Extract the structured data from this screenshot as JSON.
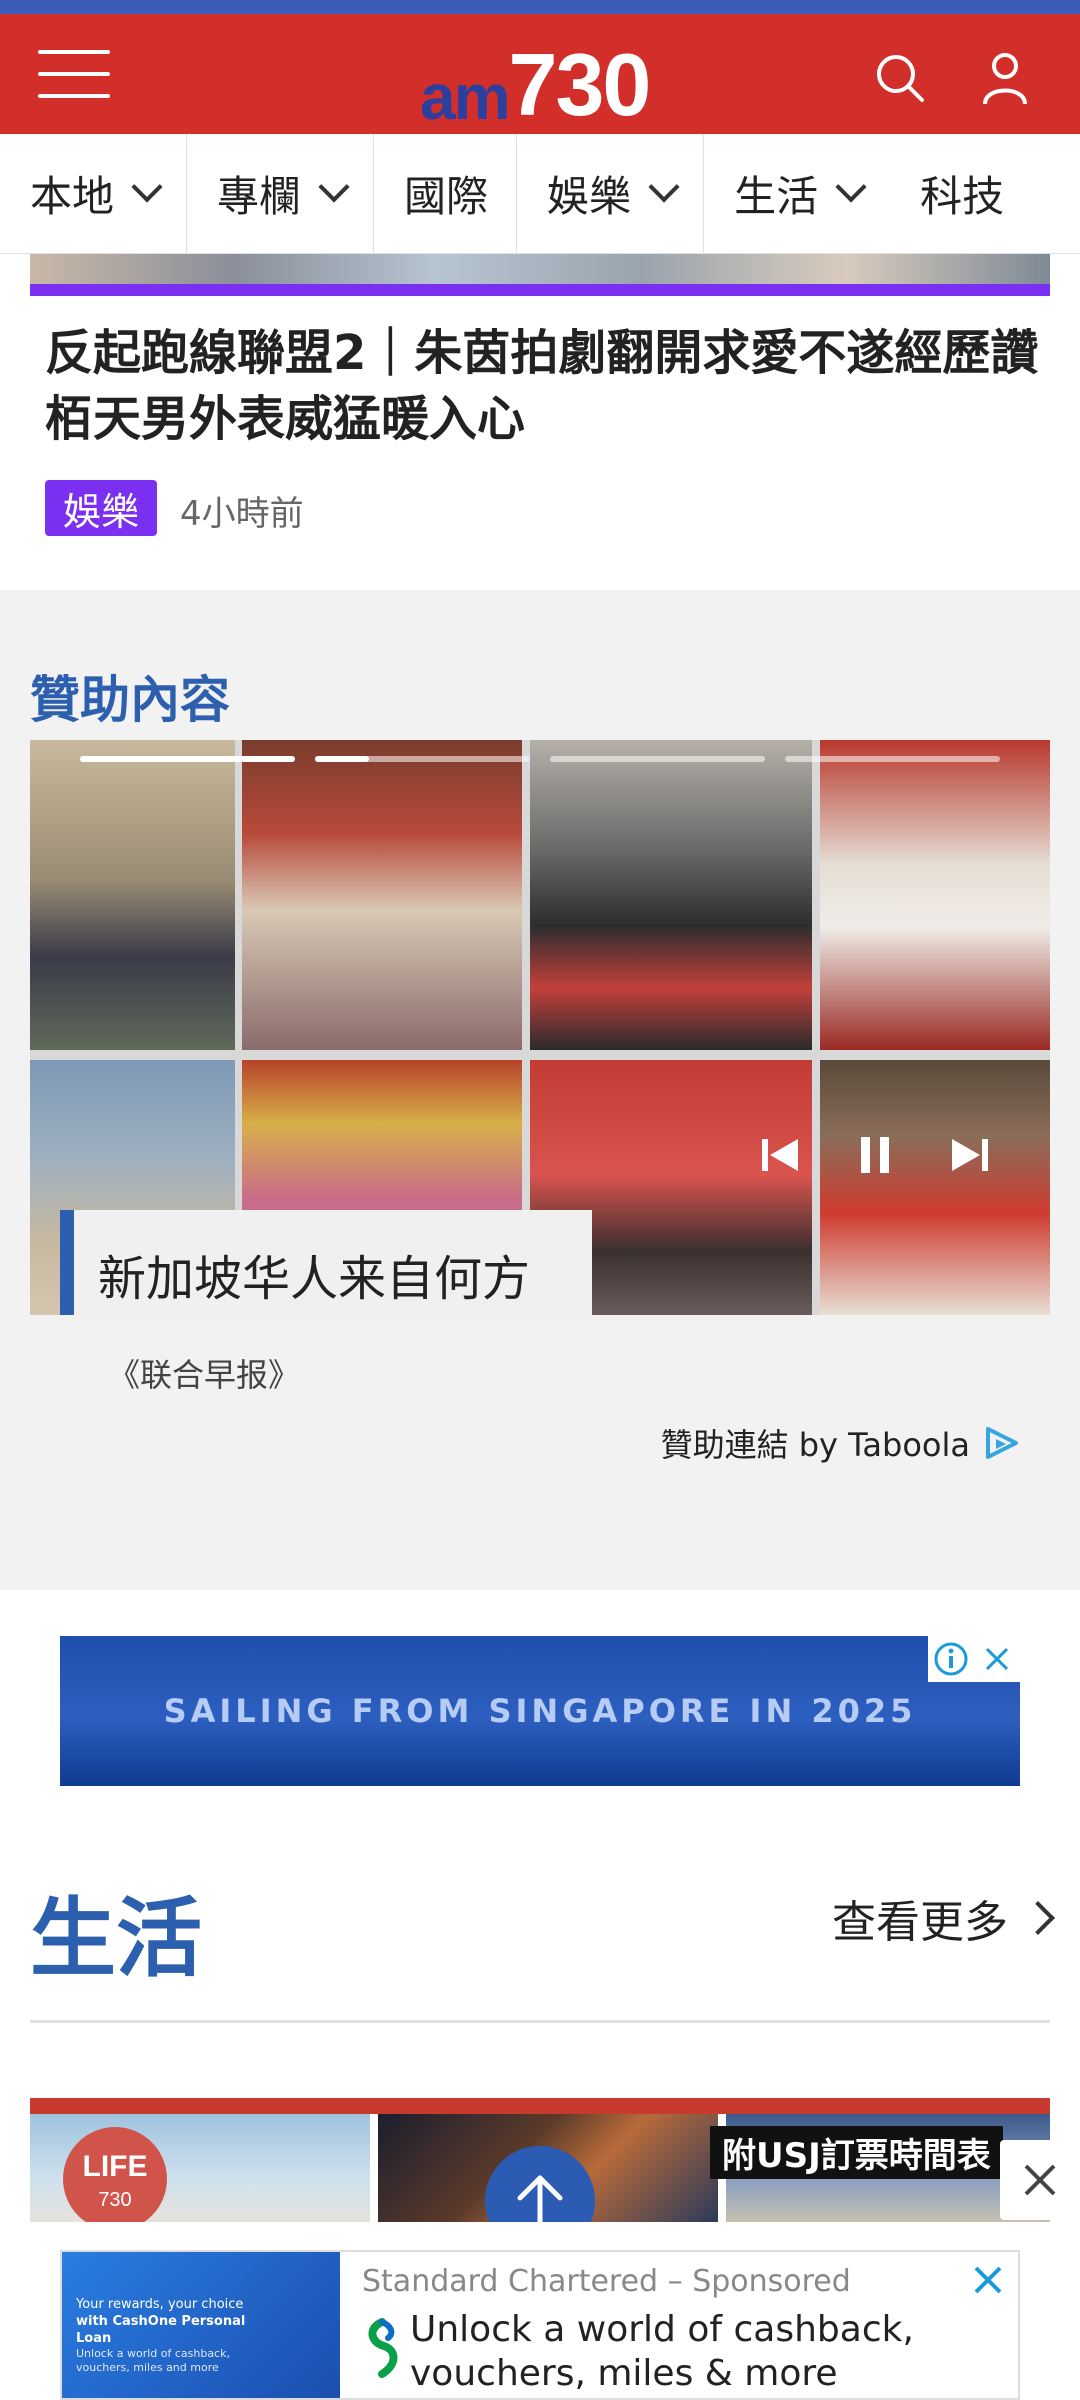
{
  "header": {
    "logo_prefix": "am",
    "logo_number": "730"
  },
  "nav": {
    "categories": [
      {
        "label": "本地",
        "has_dropdown": true
      },
      {
        "label": "專欄",
        "has_dropdown": true
      },
      {
        "label": "國際",
        "has_dropdown": false
      },
      {
        "label": "娛樂",
        "has_dropdown": true
      },
      {
        "label": "生活",
        "has_dropdown": true
      },
      {
        "label": "科技",
        "has_dropdown": false
      }
    ]
  },
  "article": {
    "title": "反起跑線聯盟2｜朱茵拍劇翻開求愛不遂經歷讚栢天男外表威猛暖入心",
    "badge": "娛樂",
    "time": "4小時前"
  },
  "sponsored": {
    "heading": "贊助內容",
    "caption": "新加坡华人来自何方",
    "source": "《联合早报》",
    "taboola_label": "贊助連結 by Taboola",
    "progress_fractions": [
      1.0,
      0.25,
      0,
      0
    ]
  },
  "ad_banner": {
    "text": "SAILING FROM SINGAPORE IN 2025"
  },
  "life": {
    "title": "生活",
    "see_more": "查看更多",
    "tag": "附USJ訂票時間表"
  },
  "bottom_ad": {
    "brand": "Standard Chartered",
    "sponsored": "Sponsored",
    "headline": "Unlock a world of cashback, vouchers, miles & more",
    "img_line1": "Your rewards, your choice",
    "img_line2": "with CashOne Personal Loan",
    "img_line3": "Unlock a world of cashback, vouchers, miles and more"
  },
  "colors": {
    "header_red": "#d32f2a",
    "accent_blue": "#2c5fad",
    "badge_purple": "#7b2ff0"
  }
}
